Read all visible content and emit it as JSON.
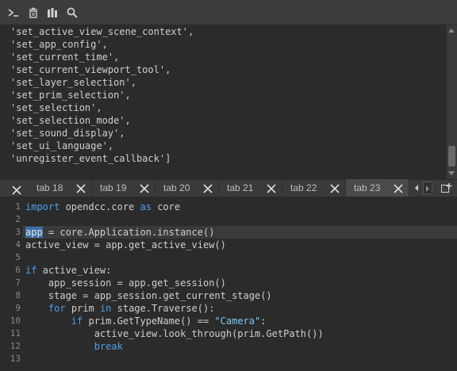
{
  "toolbar": {
    "buttons": [
      {
        "icon": "terminal-icon"
      },
      {
        "icon": "clear-icon"
      },
      {
        "icon": "output-icon"
      },
      {
        "icon": "search-icon"
      }
    ]
  },
  "output": {
    "lines": [
      "'set_active_view_scene_context',",
      "'set_app_config',",
      "'set_current_time',",
      "'set_current_viewport_tool',",
      "'set_layer_selection',",
      "'set_prim_selection',",
      "'set_selection',",
      "'set_selection_mode',",
      "'set_sound_display',",
      "'set_ui_language',",
      "'unregister_event_callback']"
    ]
  },
  "tabs": [
    {
      "label": "tab 18",
      "active": false
    },
    {
      "label": "tab 19",
      "active": false
    },
    {
      "label": "tab 20",
      "active": false
    },
    {
      "label": "tab 21",
      "active": false
    },
    {
      "label": "tab 22",
      "active": false
    },
    {
      "label": "tab 23",
      "active": true
    }
  ],
  "editor": {
    "line_numbers": [
      "1",
      "2",
      "3",
      "4",
      "5",
      "6",
      "7",
      "8",
      "9",
      "10",
      "11",
      "12",
      "13"
    ],
    "code": {
      "l1_kw1": "import",
      "l1_mid": " opendcc.core ",
      "l1_kw2": "as",
      "l1_end": " core",
      "l3_sel": "app",
      "l3_rest": " = core.Application.instance()",
      "l4": "active_view = app.get_active_view()",
      "l6_kw": "if",
      "l6_rest": " active_view:",
      "l7": "    app_session = app.get_session()",
      "l8": "    stage = app_session.get_current_stage()",
      "l9_indent": "    ",
      "l9_kw1": "for",
      "l9_mid": " prim ",
      "l9_kw2": "in",
      "l9_end": " stage.Traverse():",
      "l10_indent": "        ",
      "l10_kw": "if",
      "l10_mid": " prim.GetTypeName() == ",
      "l10_str": "\"Camera\"",
      "l10_end": ":",
      "l11": "            active_view.look_through(prim.GetPath())",
      "l12_indent": "            ",
      "l12_kw": "break"
    }
  },
  "colors": {
    "keyword": "#4e9fe8",
    "string": "#7cc7f0",
    "selection": "#3d6fa6"
  }
}
